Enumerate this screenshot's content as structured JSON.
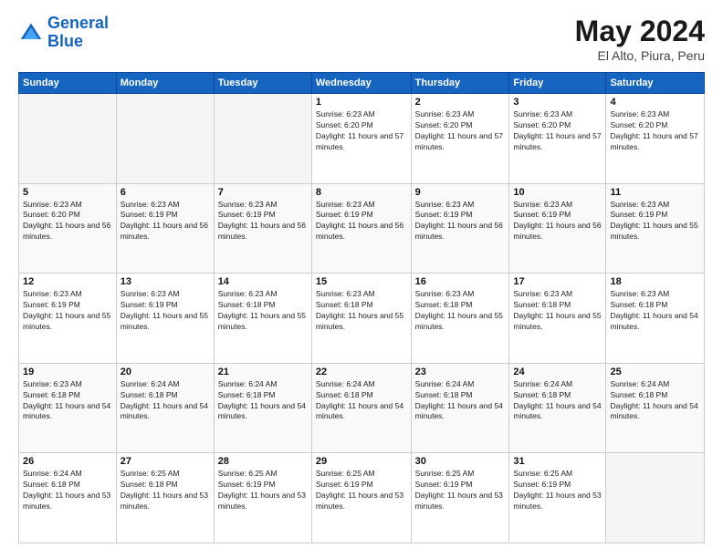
{
  "header": {
    "logo_line1": "General",
    "logo_line2": "Blue",
    "month": "May 2024",
    "location": "El Alto, Piura, Peru"
  },
  "weekdays": [
    "Sunday",
    "Monday",
    "Tuesday",
    "Wednesday",
    "Thursday",
    "Friday",
    "Saturday"
  ],
  "weeks": [
    [
      {
        "day": "",
        "empty": true
      },
      {
        "day": "",
        "empty": true
      },
      {
        "day": "",
        "empty": true
      },
      {
        "day": "1",
        "sunrise": "6:23 AM",
        "sunset": "6:20 PM",
        "daylight": "11 hours and 57 minutes."
      },
      {
        "day": "2",
        "sunrise": "6:23 AM",
        "sunset": "6:20 PM",
        "daylight": "11 hours and 57 minutes."
      },
      {
        "day": "3",
        "sunrise": "6:23 AM",
        "sunset": "6:20 PM",
        "daylight": "11 hours and 57 minutes."
      },
      {
        "day": "4",
        "sunrise": "6:23 AM",
        "sunset": "6:20 PM",
        "daylight": "11 hours and 57 minutes."
      }
    ],
    [
      {
        "day": "5",
        "sunrise": "6:23 AM",
        "sunset": "6:20 PM",
        "daylight": "11 hours and 56 minutes."
      },
      {
        "day": "6",
        "sunrise": "6:23 AM",
        "sunset": "6:19 PM",
        "daylight": "11 hours and 56 minutes."
      },
      {
        "day": "7",
        "sunrise": "6:23 AM",
        "sunset": "6:19 PM",
        "daylight": "11 hours and 56 minutes."
      },
      {
        "day": "8",
        "sunrise": "6:23 AM",
        "sunset": "6:19 PM",
        "daylight": "11 hours and 56 minutes."
      },
      {
        "day": "9",
        "sunrise": "6:23 AM",
        "sunset": "6:19 PM",
        "daylight": "11 hours and 56 minutes."
      },
      {
        "day": "10",
        "sunrise": "6:23 AM",
        "sunset": "6:19 PM",
        "daylight": "11 hours and 56 minutes."
      },
      {
        "day": "11",
        "sunrise": "6:23 AM",
        "sunset": "6:19 PM",
        "daylight": "11 hours and 55 minutes."
      }
    ],
    [
      {
        "day": "12",
        "sunrise": "6:23 AM",
        "sunset": "6:19 PM",
        "daylight": "11 hours and 55 minutes."
      },
      {
        "day": "13",
        "sunrise": "6:23 AM",
        "sunset": "6:19 PM",
        "daylight": "11 hours and 55 minutes."
      },
      {
        "day": "14",
        "sunrise": "6:23 AM",
        "sunset": "6:18 PM",
        "daylight": "11 hours and 55 minutes."
      },
      {
        "day": "15",
        "sunrise": "6:23 AM",
        "sunset": "6:18 PM",
        "daylight": "11 hours and 55 minutes."
      },
      {
        "day": "16",
        "sunrise": "6:23 AM",
        "sunset": "6:18 PM",
        "daylight": "11 hours and 55 minutes."
      },
      {
        "day": "17",
        "sunrise": "6:23 AM",
        "sunset": "6:18 PM",
        "daylight": "11 hours and 55 minutes."
      },
      {
        "day": "18",
        "sunrise": "6:23 AM",
        "sunset": "6:18 PM",
        "daylight": "11 hours and 54 minutes."
      }
    ],
    [
      {
        "day": "19",
        "sunrise": "6:23 AM",
        "sunset": "6:18 PM",
        "daylight": "11 hours and 54 minutes."
      },
      {
        "day": "20",
        "sunrise": "6:24 AM",
        "sunset": "6:18 PM",
        "daylight": "11 hours and 54 minutes."
      },
      {
        "day": "21",
        "sunrise": "6:24 AM",
        "sunset": "6:18 PM",
        "daylight": "11 hours and 54 minutes."
      },
      {
        "day": "22",
        "sunrise": "6:24 AM",
        "sunset": "6:18 PM",
        "daylight": "11 hours and 54 minutes."
      },
      {
        "day": "23",
        "sunrise": "6:24 AM",
        "sunset": "6:18 PM",
        "daylight": "11 hours and 54 minutes."
      },
      {
        "day": "24",
        "sunrise": "6:24 AM",
        "sunset": "6:18 PM",
        "daylight": "11 hours and 54 minutes."
      },
      {
        "day": "25",
        "sunrise": "6:24 AM",
        "sunset": "6:18 PM",
        "daylight": "11 hours and 54 minutes."
      }
    ],
    [
      {
        "day": "26",
        "sunrise": "6:24 AM",
        "sunset": "6:18 PM",
        "daylight": "11 hours and 53 minutes."
      },
      {
        "day": "27",
        "sunrise": "6:25 AM",
        "sunset": "6:18 PM",
        "daylight": "11 hours and 53 minutes."
      },
      {
        "day": "28",
        "sunrise": "6:25 AM",
        "sunset": "6:19 PM",
        "daylight": "11 hours and 53 minutes."
      },
      {
        "day": "29",
        "sunrise": "6:25 AM",
        "sunset": "6:19 PM",
        "daylight": "11 hours and 53 minutes."
      },
      {
        "day": "30",
        "sunrise": "6:25 AM",
        "sunset": "6:19 PM",
        "daylight": "11 hours and 53 minutes."
      },
      {
        "day": "31",
        "sunrise": "6:25 AM",
        "sunset": "6:19 PM",
        "daylight": "11 hours and 53 minutes."
      },
      {
        "day": "",
        "empty": true
      }
    ]
  ],
  "labels": {
    "sunrise": "Sunrise:",
    "sunset": "Sunset:",
    "daylight": "Daylight:"
  }
}
